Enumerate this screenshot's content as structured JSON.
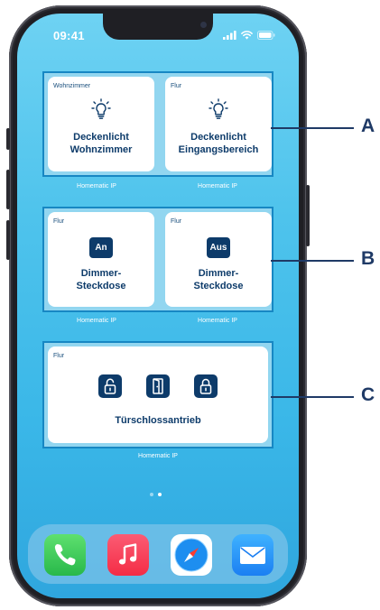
{
  "status_bar": {
    "time": "09:41"
  },
  "widgets": {
    "lights": [
      {
        "room": "Wohnzimmer",
        "title_line1": "Deckenlicht",
        "title_line2": "Wohnzimmer",
        "icon": "lightbulb-icon"
      },
      {
        "room": "Flur",
        "title_line1": "Deckenlicht",
        "title_line2": "Eingangsbereich",
        "icon": "lightbulb-icon"
      }
    ],
    "lights_provider": [
      "Homematic IP",
      "Homematic IP"
    ],
    "dimmers": [
      {
        "room": "Flur",
        "button": "An",
        "title_line1": "Dimmer-",
        "title_line2": "Steckdose"
      },
      {
        "room": "Flur",
        "button": "Aus",
        "title_line1": "Dimmer-",
        "title_line2": "Steckdose"
      }
    ],
    "dimmers_provider": [
      "Homematic IP",
      "Homematic IP"
    ],
    "door": {
      "room": "Flur",
      "title": "Türschlossantrieb",
      "provider": "Homematic IP",
      "buttons": [
        "unlock-icon",
        "door-open-icon",
        "lock-icon"
      ]
    }
  },
  "page_indicator": {
    "pages": 2,
    "current": 2
  },
  "dock": {
    "apps": [
      {
        "name": "phone-app",
        "color": "#3fd05a"
      },
      {
        "name": "music-app",
        "color": "#f5334f"
      },
      {
        "name": "safari-app",
        "color": "#1e88e5"
      },
      {
        "name": "mail-app",
        "color": "#2a8df0"
      }
    ]
  },
  "callouts": [
    "A",
    "B",
    "C"
  ],
  "colors": {
    "navy": "#0d3b6a",
    "group_border": "#1787c3",
    "callout": "#1f3a66"
  }
}
